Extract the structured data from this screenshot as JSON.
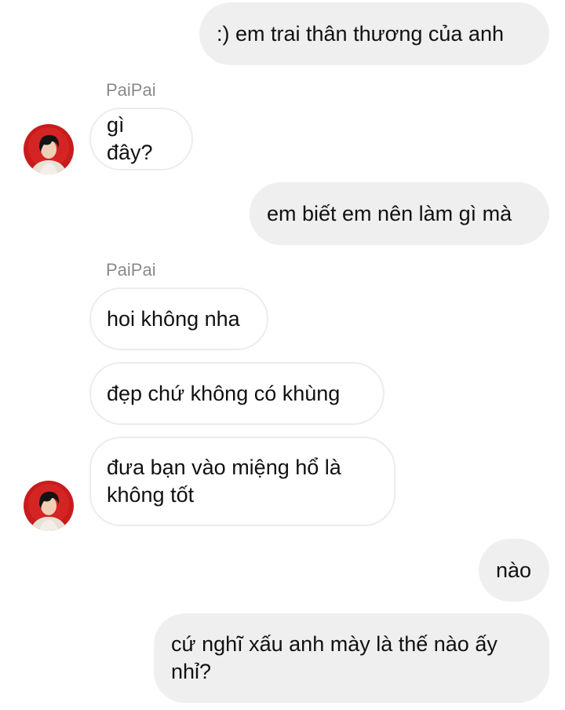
{
  "contact": {
    "name": "PaiPai",
    "avatar_icon": "profile-photo"
  },
  "colors": {
    "outgoing_bubble": "#efefef",
    "incoming_border": "#ececec",
    "sender_label": "#8a8a8a",
    "avatar_bg": "#c81c1c"
  },
  "messages": [
    {
      "from": "me",
      "text": ":) em trai thân thương của anh"
    },
    {
      "from": "PaiPai",
      "sender": "PaiPai",
      "text": "gì đây?"
    },
    {
      "from": "me",
      "text": "em biết em nên làm gì mà"
    },
    {
      "from": "PaiPai",
      "sender": "PaiPai",
      "text": "hoi không nha"
    },
    {
      "from": "PaiPai",
      "text": "đẹp chứ không có khùng"
    },
    {
      "from": "PaiPai",
      "text": "đưa bạn vào miệng hổ là\nkhông tốt"
    },
    {
      "from": "me",
      "text": "nào"
    },
    {
      "from": "me",
      "text": "cứ nghĩ xấu anh mày là thế nào ấy\nnhỉ?"
    }
  ]
}
